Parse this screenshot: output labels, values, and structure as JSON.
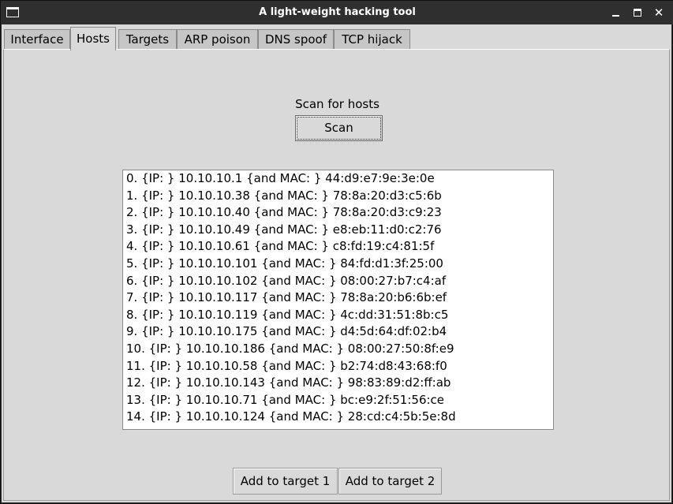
{
  "window": {
    "title": "A light-weight hacking tool",
    "icons": {
      "app": "window-icon",
      "minimize": "minimize-icon",
      "maximize": "maximize-icon",
      "close": "close-icon"
    },
    "close_glyph": "✕"
  },
  "tabs": [
    {
      "label": "Interface",
      "active": false
    },
    {
      "label": "Hosts",
      "active": true
    },
    {
      "label": "Targets",
      "active": false
    },
    {
      "label": "ARP poison",
      "active": false
    },
    {
      "label": "DNS spoof",
      "active": false
    },
    {
      "label": "TCP hijack",
      "active": false
    }
  ],
  "hosts_tab": {
    "scan_label": "Scan for hosts",
    "scan_button": "Scan",
    "hosts": [
      "0. {IP: } 10.10.10.1 {and MAC: } 44:d9:e7:9e:3e:0e",
      "1. {IP: } 10.10.10.38 {and MAC: } 78:8a:20:d3:c5:6b",
      "2. {IP: } 10.10.10.40 {and MAC: } 78:8a:20:d3:c9:23",
      "3. {IP: } 10.10.10.49 {and MAC: } e8:eb:11:d0:c2:76",
      "4. {IP: } 10.10.10.61 {and MAC: } c8:fd:19:c4:81:5f",
      "5. {IP: } 10.10.10.101 {and MAC: } 84:fd:d1:3f:25:00",
      "6. {IP: } 10.10.10.102 {and MAC: } 08:00:27:b7:c4:af",
      "7. {IP: } 10.10.10.117 {and MAC: } 78:8a:20:b6:6b:ef",
      "8. {IP: } 10.10.10.119 {and MAC: } 4c:dd:31:51:8b:c5",
      "9. {IP: } 10.10.10.175 {and MAC: } d4:5d:64:df:02:b4",
      "10. {IP: } 10.10.10.186 {and MAC: } 08:00:27:50:8f:e9",
      "11. {IP: } 10.10.10.58 {and MAC: } b2:74:d8:43:68:f0",
      "12. {IP: } 10.10.10.143 {and MAC: } 98:83:89:d2:ff:ab",
      "13. {IP: } 10.10.10.71 {and MAC: } bc:e9:2f:51:56:ce",
      "14. {IP: } 10.10.10.124 {and MAC: } 28:cd:c4:5b:5e:8d"
    ],
    "add_target_1": "Add to target 1",
    "add_target_2": "Add to target 2"
  },
  "colors": {
    "titlebar": "#2f2f2f",
    "client_bg": "#d9d9d9",
    "inactive_tab": "#c6c6c6",
    "listbox_bg": "#ffffff"
  }
}
